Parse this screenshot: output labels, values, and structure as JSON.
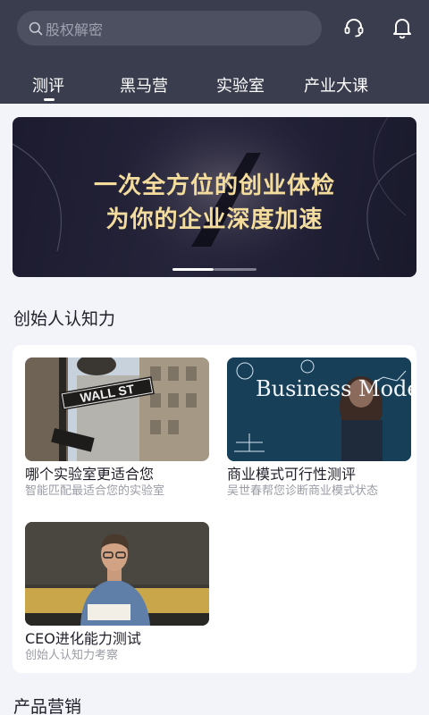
{
  "search": {
    "placeholder": "股权解密",
    "icon": "search-icon"
  },
  "header_icons": [
    "headset-icon",
    "bell-icon"
  ],
  "tabs": [
    {
      "label": "测评",
      "active": true
    },
    {
      "label": "黑马营",
      "active": false
    },
    {
      "label": "实验室",
      "active": false
    },
    {
      "label": "产业大课",
      "active": false
    }
  ],
  "banner": {
    "line1": "一次全方位的创业体检",
    "line2": "为你的企业深度加速",
    "slide_count": 2,
    "active_slide": 1
  },
  "section1": {
    "title": "创始人认知力",
    "items": [
      {
        "title": "哪个实验室更适合您",
        "subtitle": "智能匹配最适合您的实验室",
        "image_text": "WALL ST"
      },
      {
        "title": "商业模式可行性测评",
        "subtitle": "吴世春帮您诊断商业模式状态",
        "image_text": "Business Model"
      },
      {
        "title": "CEO进化能力测试",
        "subtitle": "创始人认知力考察"
      }
    ]
  },
  "section2": {
    "title": "产品营销"
  },
  "colors": {
    "header_bg": "#3a3d4d",
    "page_bg": "#f3f4f9",
    "banner_text": "#f3dc9c"
  }
}
